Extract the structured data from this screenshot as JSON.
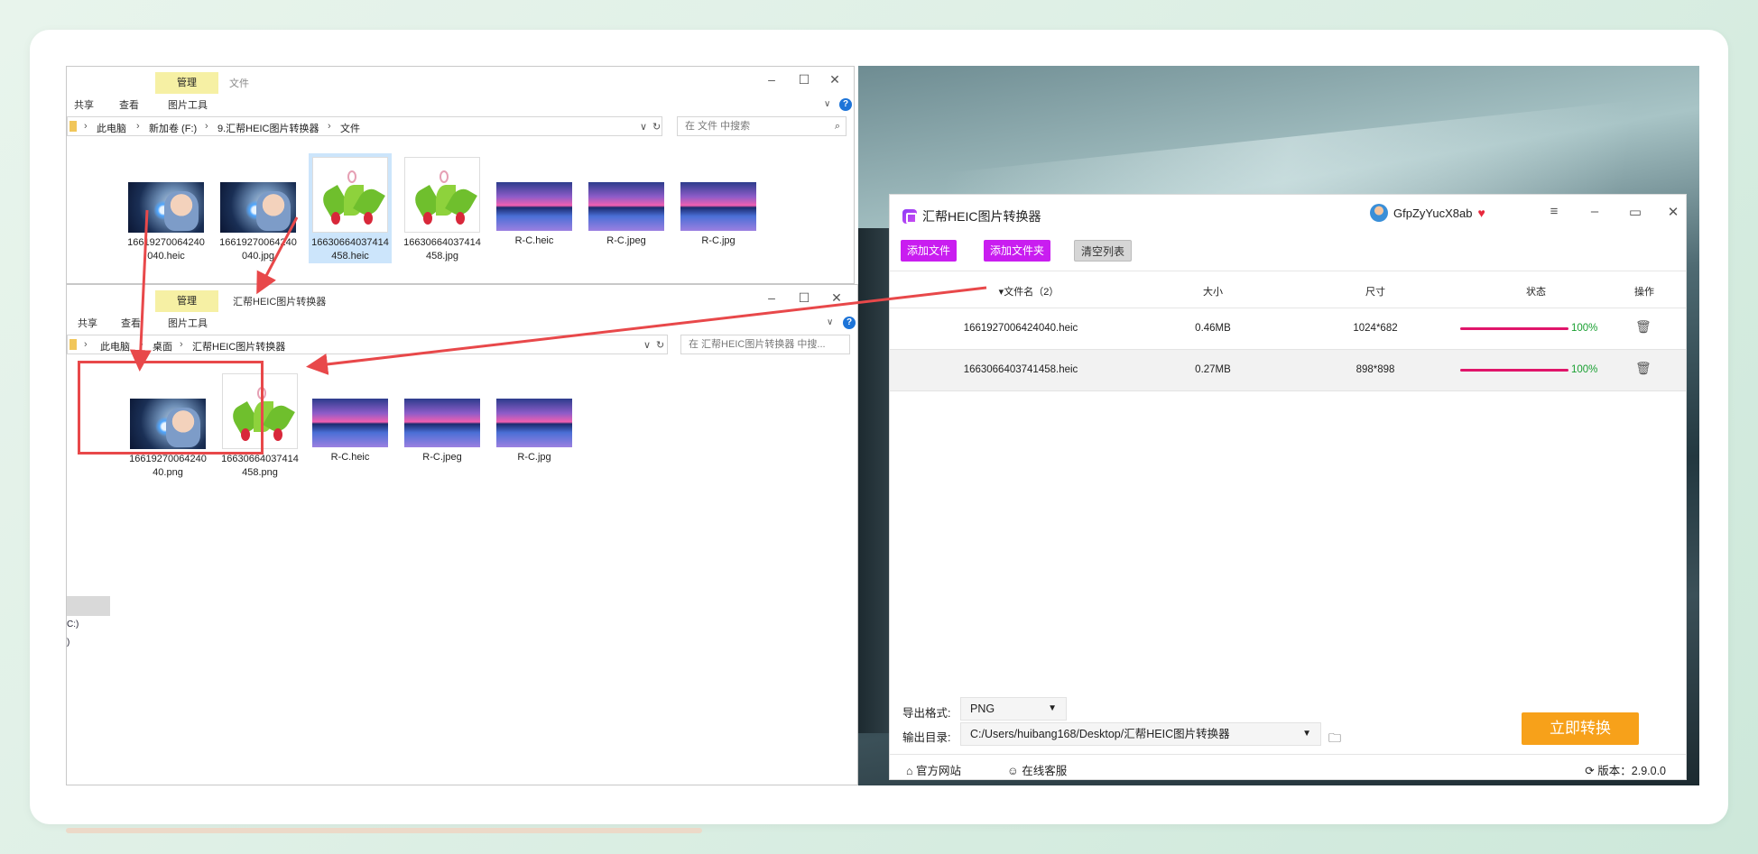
{
  "explorer_top": {
    "tab_manage": "管理",
    "tab_file": "文件",
    "tab_share": "共享",
    "tab_view": "查看",
    "tab_picture_tools": "图片工具",
    "breadcrumb": [
      "此电脑",
      "新加卷 (F:)",
      "9.汇帮HEIC图片转换器",
      "文件"
    ],
    "search_placeholder": "在 文件 中搜索",
    "files": [
      {
        "name": "1661927006424040.heic",
        "line1": "16619270064240",
        "line2": "040.heic",
        "kind": "photo"
      },
      {
        "name": "1661927006424040.jpg",
        "line1": "16619270064240",
        "line2": "040.jpg",
        "kind": "photo"
      },
      {
        "name": "1663066403741458.heic",
        "line1": "16630664037414",
        "line2": "458.heic",
        "kind": "zongzi"
      },
      {
        "name": "1663066403741458.jpg",
        "line1": "16630664037414",
        "line2": "458.jpg",
        "kind": "zongzi"
      },
      {
        "name": "R-C.heic",
        "line1": "R-C.heic",
        "line2": "",
        "kind": "lake"
      },
      {
        "name": "R-C.jpeg",
        "line1": "R-C.jpeg",
        "line2": "",
        "kind": "lake"
      },
      {
        "name": "R-C.jpg",
        "line1": "R-C.jpg",
        "line2": "",
        "kind": "lake"
      }
    ]
  },
  "explorer_bottom": {
    "tab_manage": "管理",
    "window_title": "汇帮HEIC图片转换器",
    "tab_share": "共享",
    "tab_view": "查看",
    "tab_picture_tools": "图片工具",
    "breadcrumb": [
      "此电脑",
      "桌面",
      "汇帮HEIC图片转换器"
    ],
    "search_placeholder": "在 汇帮HEIC图片转换器 中搜...",
    "sidebar_labels": [
      "C:)",
      ")"
    ],
    "files": [
      {
        "name": "1661927006424040.png",
        "line1": "16619270064240",
        "line2": "40.png",
        "kind": "photo"
      },
      {
        "name": "1663066403741458.png",
        "line1": "16630664037414",
        "line2": "458.png",
        "kind": "zongzi"
      },
      {
        "name": "R-C.heic",
        "line1": "R-C.heic",
        "line2": "",
        "kind": "lake"
      },
      {
        "name": "R-C.jpeg",
        "line1": "R-C.jpeg",
        "line2": "",
        "kind": "lake"
      },
      {
        "name": "R-C.jpg",
        "line1": "R-C.jpg",
        "line2": "",
        "kind": "lake"
      }
    ]
  },
  "app": {
    "title": "汇帮HEIC图片转换器",
    "username": "GfpZyYucX8ab",
    "buttons": {
      "add_file": "添加文件",
      "add_folder": "添加文件夹",
      "clear_list": "清空列表"
    },
    "columns": {
      "name": "▾文件名（2）",
      "size": "大小",
      "dimensions": "尺寸",
      "status": "状态",
      "action": "操作"
    },
    "rows": [
      {
        "name": "1661927006424040.heic",
        "size": "0.46MB",
        "dimensions": "1024*682",
        "progress": 1.0,
        "percent": "100%"
      },
      {
        "name": "1663066403741458.heic",
        "size": "0.27MB",
        "dimensions": "898*898",
        "progress": 1.0,
        "percent": "100%"
      }
    ],
    "export_format_label": "导出格式:",
    "export_format_value": "PNG",
    "output_dir_label": "输出目录:",
    "output_dir_value": "C:/Users/huibang168/Desktop/汇帮HEIC图片转换器",
    "convert_button": "立即转换",
    "official_site": "官方网站",
    "online_service": "在线客服",
    "version": "版本：2.9.0.0"
  },
  "colors": {
    "accent_purple": "#c91df0",
    "convert_orange": "#f7a11a",
    "progress": "#e0156a",
    "percent_green": "#1aa032",
    "annotation_red": "#e8484a"
  }
}
